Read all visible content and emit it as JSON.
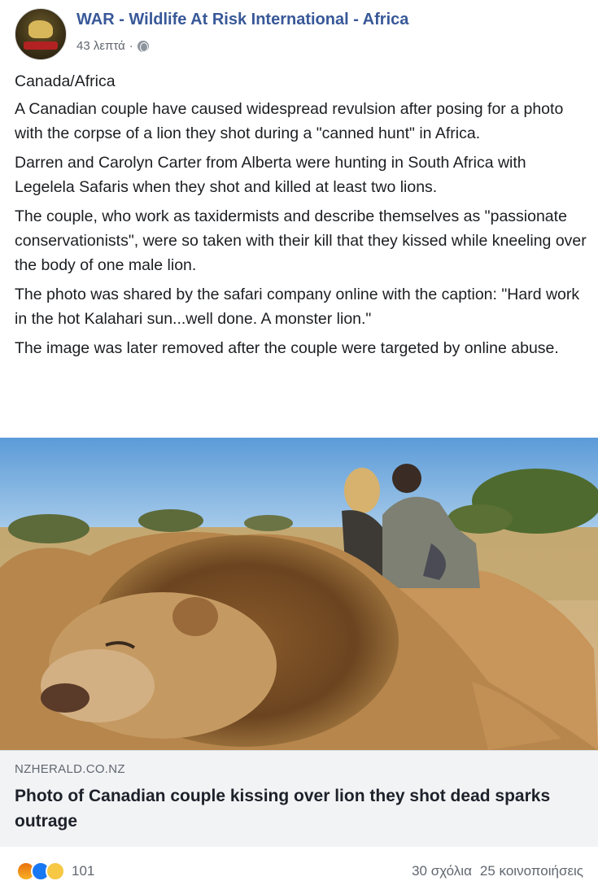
{
  "post": {
    "page_name": "WAR - Wildlife At Risk International - Africa",
    "time": "43 λεπτά",
    "separator": "·",
    "privacy_icon": "globe-icon",
    "paragraphs": [
      "Canada/Africa",
      "A Canadian couple have caused widespread revulsion after posing for a photo with the corpse of a lion they shot during a \"canned hunt\" in Africa.",
      "Darren and Carolyn Carter from Alberta were hunting in South Africa with Legelela Safaris when they shot and killed at least two lions.",
      "The couple, who work as taxidermists and describe themselves as \"passionate conservationists\", were so taken with their kill that they kissed while kneeling over the body of one male lion.",
      "The photo was shared by the safari company online with the caption: \"Hard work in the hot Kalahari sun...well done. A monster lion.\"",
      "The image was later removed after the couple were targeted by online abuse."
    ]
  },
  "link_preview": {
    "domain": "NZHERALD.CO.NZ",
    "headline": "Photo of Canadian couple kissing over lion they shot dead sparks outrage"
  },
  "footer": {
    "reaction_icons": [
      "angry-icon",
      "like-icon",
      "sad-icon"
    ],
    "reaction_count": "101",
    "comments": "30 σχόλια",
    "shares": "25 κοινοποιήσεις"
  },
  "colors": {
    "link_blue": "#385898",
    "preview_bg": "#f2f3f5"
  }
}
